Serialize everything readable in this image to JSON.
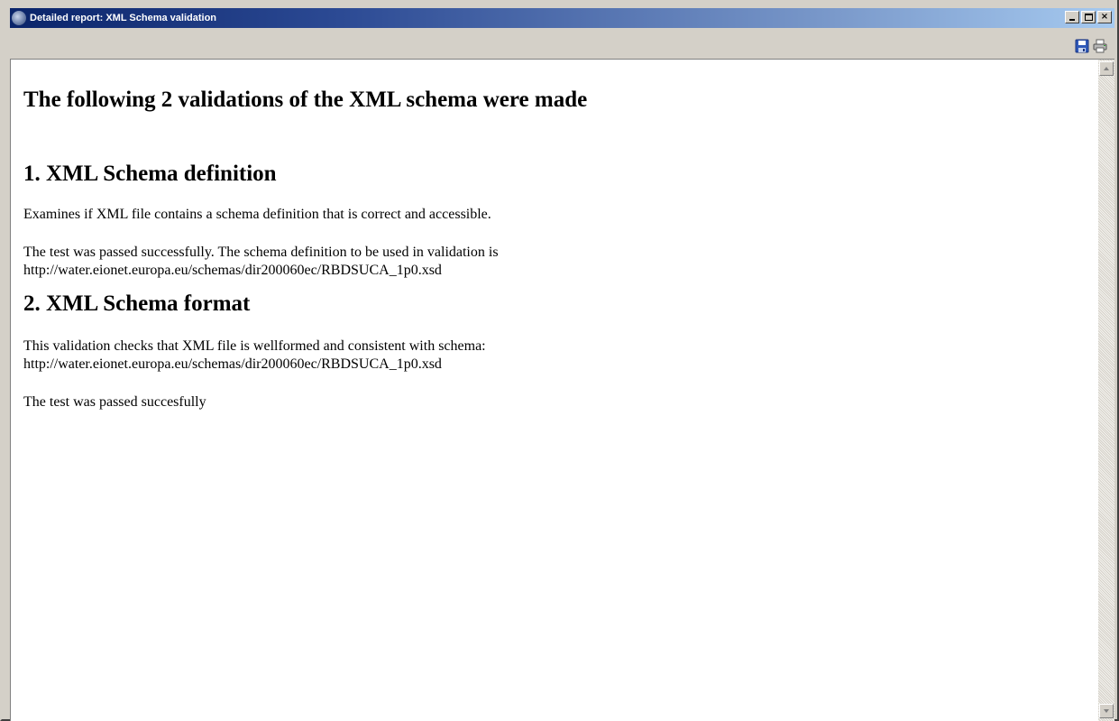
{
  "window": {
    "title": "Detailed report: XML Schema validation",
    "icon": "globe-icon",
    "buttons": {
      "minimize": "minimize-icon",
      "maximize": "maximize-icon",
      "close": "×"
    }
  },
  "toolbar": {
    "save_icon": "save-icon",
    "print_icon": "print-icon"
  },
  "report": {
    "heading": "The following 2 validations of the XML schema were made",
    "sections": [
      {
        "title": "1. XML Schema definition",
        "description": "Examines if XML file contains a schema definition that is correct and accessible.",
        "result_line1": "The test was passed successfully. The schema definition to be used in validation is",
        "result_line2": "http://water.eionet.europa.eu/schemas/dir200060ec/RBDSUCA_1p0.xsd"
      },
      {
        "title": "2. XML Schema format",
        "description_line1": "This validation checks that XML file is wellformed and consistent with schema:",
        "description_line2": "http://water.eionet.europa.eu/schemas/dir200060ec/RBDSUCA_1p0.xsd",
        "result": "The test was passed succesfully"
      }
    ]
  },
  "colors": {
    "titlebar_start": "#0a246a",
    "titlebar_end": "#a6caf0",
    "chrome": "#d4d0c8"
  }
}
